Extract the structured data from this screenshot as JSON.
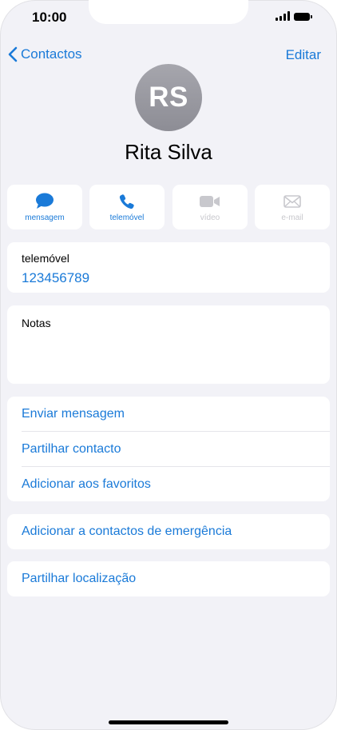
{
  "status_bar": {
    "time": "10:00"
  },
  "nav": {
    "back_label": "Contactos",
    "edit_label": "Editar"
  },
  "contact": {
    "initials": "RS",
    "name": "Rita Silva"
  },
  "actions": [
    {
      "label": "mensagem",
      "icon": "message-bubble-icon",
      "enabled": true
    },
    {
      "label": "telemóvel",
      "icon": "phone-icon",
      "enabled": true
    },
    {
      "label": "vídeo",
      "icon": "video-camera-icon",
      "enabled": false
    },
    {
      "label": "e-mail",
      "icon": "envelope-icon",
      "enabled": false
    }
  ],
  "phone_field": {
    "label": "telemóvel",
    "value": "123456789"
  },
  "notes": {
    "label": "Notas"
  },
  "options": [
    {
      "label": "Enviar mensagem"
    },
    {
      "label": "Partilhar contacto"
    },
    {
      "label": "Adicionar aos favoritos"
    }
  ],
  "emergency": {
    "label": "Adicionar a contactos de emergência"
  },
  "location": {
    "label": "Partilhar localização"
  },
  "colors": {
    "accent": "#1a7ad8",
    "background": "#f2f2f7",
    "disabled": "#c8c8cd"
  }
}
